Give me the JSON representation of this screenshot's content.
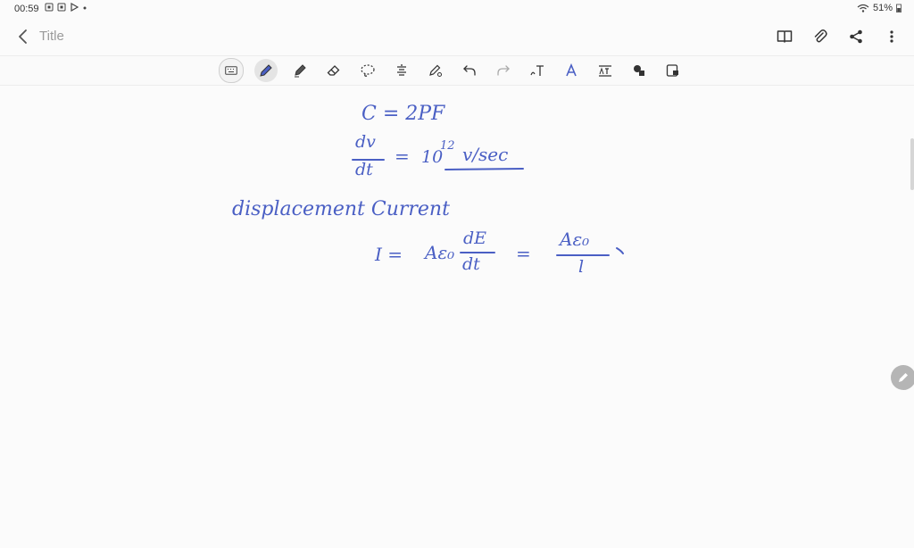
{
  "status_bar": {
    "time": "00:59",
    "battery": "51%"
  },
  "app_bar": {
    "title": "Title"
  },
  "note": {
    "line1": "C = 2PF",
    "dv": "dv",
    "dt": "dt",
    "eq": "=",
    "ten": "10",
    "exp": "12",
    "unit": "v/sec",
    "label": "displacement Current",
    "i_eq": "I =",
    "a_eps": "Aε₀",
    "dE": "dE",
    "dt2": "dt",
    "eq2": "=",
    "a_eps2": "Aε₀",
    "l": "l"
  },
  "colors": {
    "ink": "#4a5fc4"
  }
}
